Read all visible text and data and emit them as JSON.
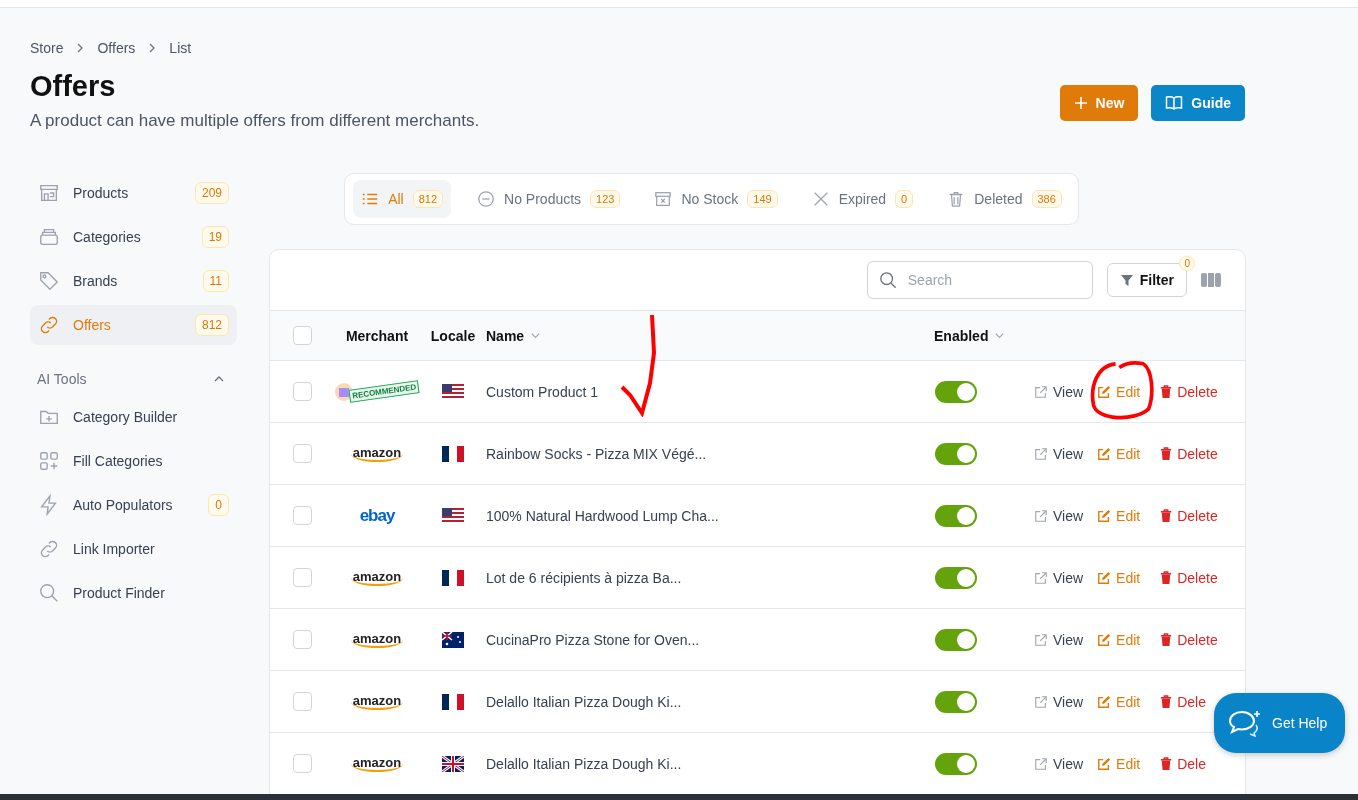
{
  "breadcrumb": [
    "Store",
    "Offers",
    "List"
  ],
  "title": "Offers",
  "subtitle": "A product can have multiple offers from different merchants.",
  "header_buttons": [
    {
      "kind": "new",
      "label": "New"
    },
    {
      "kind": "guide",
      "label": "Guide"
    }
  ],
  "sidebar": {
    "items": [
      {
        "label": "Products",
        "count": "209",
        "selected": false
      },
      {
        "label": "Categories",
        "count": "19",
        "selected": false
      },
      {
        "label": "Brands",
        "count": "11",
        "selected": false
      },
      {
        "label": "Offers",
        "count": "812",
        "selected": true
      }
    ],
    "section": {
      "label": "AI Tools",
      "expanded": true,
      "items": [
        {
          "label": "Category Builder"
        },
        {
          "label": "Fill Categories"
        },
        {
          "label": "Auto Populators",
          "count": "0"
        },
        {
          "label": "Link Importer"
        },
        {
          "label": "Product Finder"
        }
      ]
    }
  },
  "tabs": [
    {
      "label": "All",
      "count": "812",
      "selected": true
    },
    {
      "label": "No Products",
      "count": "123",
      "selected": false
    },
    {
      "label": "No Stock",
      "count": "149",
      "selected": false
    },
    {
      "label": "Expired",
      "count": "0",
      "selected": false
    },
    {
      "label": "Deleted",
      "count": "386",
      "selected": false
    }
  ],
  "toolbar": {
    "search_placeholder": "Search",
    "filter_label": "Filter",
    "filter_count": "0"
  },
  "table": {
    "select_all_checked": false,
    "columns": [
      {
        "label": "Merchant",
        "sortable": false
      },
      {
        "label": "Locale",
        "sortable": false
      },
      {
        "label": "Name",
        "sortable": true
      },
      {
        "label": "Enabled",
        "sortable": true
      }
    ],
    "rows": [
      {
        "merchant": {
          "kind": "stamp",
          "text": "RECOMMENDED"
        },
        "flag": {
          "kind": "us"
        },
        "name": "Custom Product 1",
        "enabled": true,
        "checked": false,
        "view": "View",
        "edit": "Edit",
        "delete": "Delete"
      },
      {
        "merchant": {
          "kind": "amazon",
          "text": "amazon"
        },
        "flag": {
          "kind": "fr"
        },
        "name": "Rainbow Socks - Pizza MIX Végé...",
        "enabled": true,
        "checked": false,
        "view": "View",
        "edit": "Edit",
        "delete": "Delete"
      },
      {
        "merchant": {
          "kind": "ebay",
          "text": "ebay"
        },
        "flag": {
          "kind": "us"
        },
        "name": "100% Natural Hardwood Lump Cha...",
        "enabled": true,
        "checked": false,
        "view": "View",
        "edit": "Edit",
        "delete": "Delete"
      },
      {
        "merchant": {
          "kind": "amazon",
          "text": "amazon"
        },
        "flag": {
          "kind": "fr"
        },
        "name": "Lot de 6 récipients à pizza Ba...",
        "enabled": true,
        "checked": false,
        "view": "View",
        "edit": "Edit",
        "delete": "Delete"
      },
      {
        "merchant": {
          "kind": "amazon",
          "text": "amazon"
        },
        "flag": {
          "kind": "au"
        },
        "name": "CucinaPro Pizza Stone for Oven...",
        "enabled": true,
        "checked": false,
        "view": "View",
        "edit": "Edit",
        "delete": "Delete"
      },
      {
        "merchant": {
          "kind": "amazon",
          "text": "amazon"
        },
        "flag": {
          "kind": "fr"
        },
        "name": "Delallo Italian Pizza Dough Ki...",
        "enabled": true,
        "checked": false,
        "view": "View",
        "edit": "Edit",
        "delete": "Dele"
      },
      {
        "merchant": {
          "kind": "amazon",
          "text": "amazon"
        },
        "flag": {
          "kind": "gb"
        },
        "name": "Delallo Italian Pizza Dough Ki...",
        "enabled": true,
        "checked": false,
        "view": "View",
        "edit": "Edit",
        "delete": "Dele"
      }
    ]
  },
  "help_button": "Get Help"
}
